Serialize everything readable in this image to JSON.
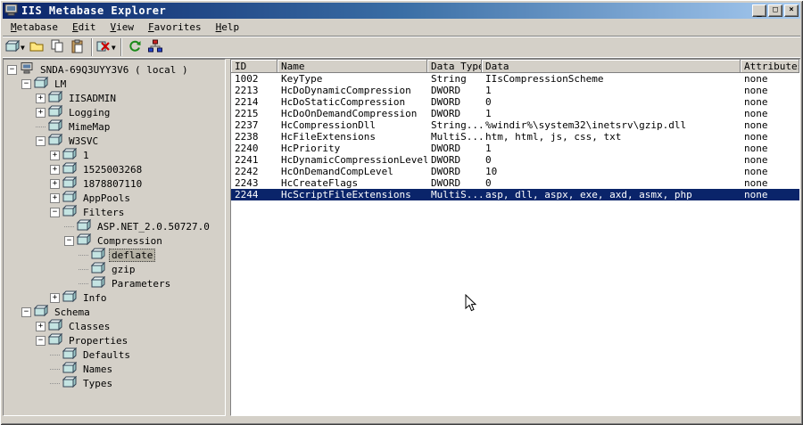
{
  "window": {
    "title": "IIS Metabase Explorer",
    "controls": [
      {
        "name": "minimize-button",
        "glyph": "_"
      },
      {
        "name": "maximize-button",
        "glyph": "□"
      },
      {
        "name": "close-button",
        "glyph": "×"
      }
    ]
  },
  "menu": {
    "items": [
      {
        "label": "Metabase"
      },
      {
        "label": "Edit"
      },
      {
        "label": "View"
      },
      {
        "label": "Favorites"
      },
      {
        "label": "Help"
      }
    ]
  },
  "toolbar": {
    "buttons": [
      {
        "name": "new-key-button",
        "icon": "key-icon",
        "dropdown": true
      },
      {
        "name": "open-key-button",
        "icon": "folder-icon"
      },
      {
        "name": "copy-button",
        "icon": "copy-icon"
      },
      {
        "name": "paste-button",
        "icon": "paste-icon"
      },
      {
        "type": "separator"
      },
      {
        "name": "delete-button",
        "icon": "delete-x-icon",
        "dropdown": true
      },
      {
        "type": "separator"
      },
      {
        "name": "refresh-button",
        "icon": "refresh-icon"
      },
      {
        "name": "connect-server-button",
        "icon": "network-icon"
      }
    ]
  },
  "tree": {
    "nodes": [
      {
        "label": "SNDA-69Q3UYY3V6 ( local )",
        "depth": 0,
        "expand": "minus",
        "icon": "computer"
      },
      {
        "label": "LM",
        "depth": 1,
        "expand": "minus",
        "icon": "db"
      },
      {
        "label": "IISADMIN",
        "depth": 2,
        "expand": "plus",
        "icon": "db"
      },
      {
        "label": "Logging",
        "depth": 2,
        "expand": "plus",
        "icon": "db"
      },
      {
        "label": "MimeMap",
        "depth": 2,
        "expand": "none",
        "icon": "db"
      },
      {
        "label": "W3SVC",
        "depth": 2,
        "expand": "minus",
        "icon": "db"
      },
      {
        "label": "1",
        "depth": 3,
        "expand": "plus",
        "icon": "db"
      },
      {
        "label": "1525003268",
        "depth": 3,
        "expand": "plus",
        "icon": "db"
      },
      {
        "label": "1878807110",
        "depth": 3,
        "expand": "plus",
        "icon": "db"
      },
      {
        "label": "AppPools",
        "depth": 3,
        "expand": "plus",
        "icon": "db"
      },
      {
        "label": "Filters",
        "depth": 3,
        "expand": "minus",
        "icon": "db"
      },
      {
        "label": "ASP.NET_2.0.50727.0",
        "depth": 4,
        "expand": "none",
        "icon": "db"
      },
      {
        "label": "Compression",
        "depth": 4,
        "expand": "minus",
        "icon": "db"
      },
      {
        "label": "deflate",
        "depth": 5,
        "expand": "none",
        "icon": "db",
        "selected": true
      },
      {
        "label": "gzip",
        "depth": 5,
        "expand": "none",
        "icon": "db"
      },
      {
        "label": "Parameters",
        "depth": 5,
        "expand": "none",
        "icon": "db"
      },
      {
        "label": "Info",
        "depth": 3,
        "expand": "plus",
        "icon": "db"
      },
      {
        "label": "Schema",
        "depth": 1,
        "expand": "minus",
        "icon": "db"
      },
      {
        "label": "Classes",
        "depth": 2,
        "expand": "plus",
        "icon": "db"
      },
      {
        "label": "Properties",
        "depth": 2,
        "expand": "minus",
        "icon": "db"
      },
      {
        "label": "Defaults",
        "depth": 3,
        "expand": "none",
        "icon": "db"
      },
      {
        "label": "Names",
        "depth": 3,
        "expand": "none",
        "icon": "db"
      },
      {
        "label": "Types",
        "depth": 3,
        "expand": "none",
        "icon": "db"
      }
    ]
  },
  "table": {
    "columns": [
      "ID",
      "Name",
      "Data Type",
      "Data",
      "Attributes"
    ],
    "rows": [
      [
        "1002",
        "KeyType",
        "String",
        "IIsCompressionScheme",
        "none"
      ],
      [
        "2213",
        "HcDoDynamicCompression",
        "DWORD",
        "1",
        "none"
      ],
      [
        "2214",
        "HcDoStaticCompression",
        "DWORD",
        "0",
        "none"
      ],
      [
        "2215",
        "HcDoOnDemandCompression",
        "DWORD",
        "1",
        "none"
      ],
      [
        "2237",
        "HcCompressionDll",
        "String...",
        "%windir%\\system32\\inetsrv\\gzip.dll",
        "none"
      ],
      [
        "2238",
        "HcFileExtensions",
        "MultiS...",
        "htm, html, js, css, txt",
        "none"
      ],
      [
        "2240",
        "HcPriority",
        "DWORD",
        "1",
        "none"
      ],
      [
        "2241",
        "HcDynamicCompressionLevel",
        "DWORD",
        "0",
        "none"
      ],
      [
        "2242",
        "HcOnDemandCompLevel",
        "DWORD",
        "10",
        "none"
      ],
      [
        "2243",
        "HcCreateFlags",
        "DWORD",
        "0",
        "none"
      ],
      [
        "2244",
        "HcScriptFileExtensions",
        "MultiS...",
        "asp, dll, aspx, exe, axd, asmx, php",
        "none"
      ]
    ],
    "selected_index": 10
  },
  "colors": {
    "titlebar_start": "#0a246a",
    "titlebar_end": "#a6caf0",
    "chrome": "#d4d0c8",
    "selection_bg": "#0a246a",
    "selection_fg": "#ffffff"
  }
}
